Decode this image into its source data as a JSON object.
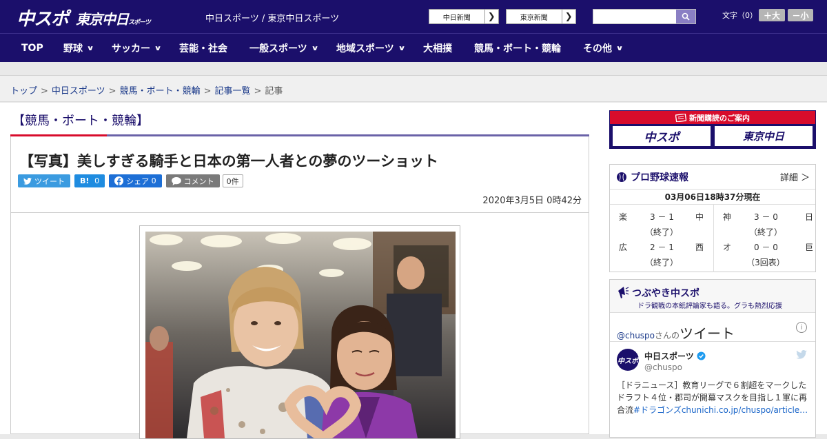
{
  "header": {
    "logo_primary": "中スポ",
    "logo_secondary": "東京中日",
    "logo_secondary_small": "スポーツ",
    "site_name": "中日スポーツ / 東京中日スポーツ",
    "paper_buttons": [
      {
        "label": "中日新聞"
      },
      {
        "label": "東京新聞"
      }
    ],
    "search_placeholder": "",
    "font_size_label": "文字（0）",
    "font_larger": "＋大",
    "font_smaller": "－小"
  },
  "nav": {
    "items": [
      {
        "label": "TOP",
        "has_dropdown": false
      },
      {
        "label": "野球",
        "has_dropdown": true
      },
      {
        "label": "サッカー",
        "has_dropdown": true
      },
      {
        "label": "芸能・社会",
        "has_dropdown": false
      },
      {
        "label": "一般スポーツ",
        "has_dropdown": true
      },
      {
        "label": "地域スポーツ",
        "has_dropdown": true
      },
      {
        "label": "大相撲",
        "has_dropdown": false
      },
      {
        "label": "競馬・ボート・競輪",
        "has_dropdown": false
      },
      {
        "label": "その他",
        "has_dropdown": true
      }
    ]
  },
  "breadcrumb": {
    "items": [
      "トップ",
      "中日スポーツ",
      "競馬・ボート・競輪",
      "記事一覧"
    ],
    "current": "記事",
    "separator": ">"
  },
  "article": {
    "category": "【競馬・ボート・競輪】",
    "title": "【写真】美しすぎる騎手と日本の第一人者との夢のツーショット",
    "share": {
      "twitter": "ツイート",
      "hatena_label": "B!",
      "hatena_count": "0",
      "facebook_label": "シェア",
      "facebook_count": "0",
      "comment_label": "コメント",
      "comment_count": "0件"
    },
    "date": "2020年3月5日 0時42分"
  },
  "sidebar": {
    "promo": {
      "top": "新聞購読のご案内",
      "left": "中スポ",
      "right": "東京中日"
    },
    "baseball": {
      "title": "プロ野球速報",
      "more": "詳細 ＞",
      "as_of": "03月06日18時37分現在",
      "games": [
        {
          "home": "楽",
          "score": "3 － 1",
          "away": "中",
          "status": "（終了）"
        },
        {
          "home": "広",
          "score": "2 － 1",
          "away": "西",
          "status": "（終了）"
        },
        {
          "home": "神",
          "score": "3 － 0",
          "away": "日",
          "status": "（終了）"
        },
        {
          "home": "オ",
          "score": "0 － 0",
          "away": "巨",
          "status": "（3回表）"
        }
      ]
    },
    "tweets": {
      "title": "つぶやき中スポ",
      "subtitle": "ドラ観戦の本紙評論家も語る。グラも熱烈応援",
      "handle": "@chuspo",
      "handle_suffix": "さんの",
      "heading": "ツイート",
      "account_name": "中日スポーツ",
      "account_handle": "@chuspo",
      "tweet_text": "［ドラニュース］教育リーグで６割超をマークしたドラフト４位・郡司が開幕マスクを目指し１軍に再合流",
      "tweet_link": "#ドラゴンズchunichi.co.jp/chuspo/article…"
    }
  },
  "colors": {
    "brand_navy": "#1b0f6b",
    "accent_red": "#d80c2c",
    "twitter_blue": "#3b9be0",
    "facebook_blue": "#1d6fd6"
  }
}
